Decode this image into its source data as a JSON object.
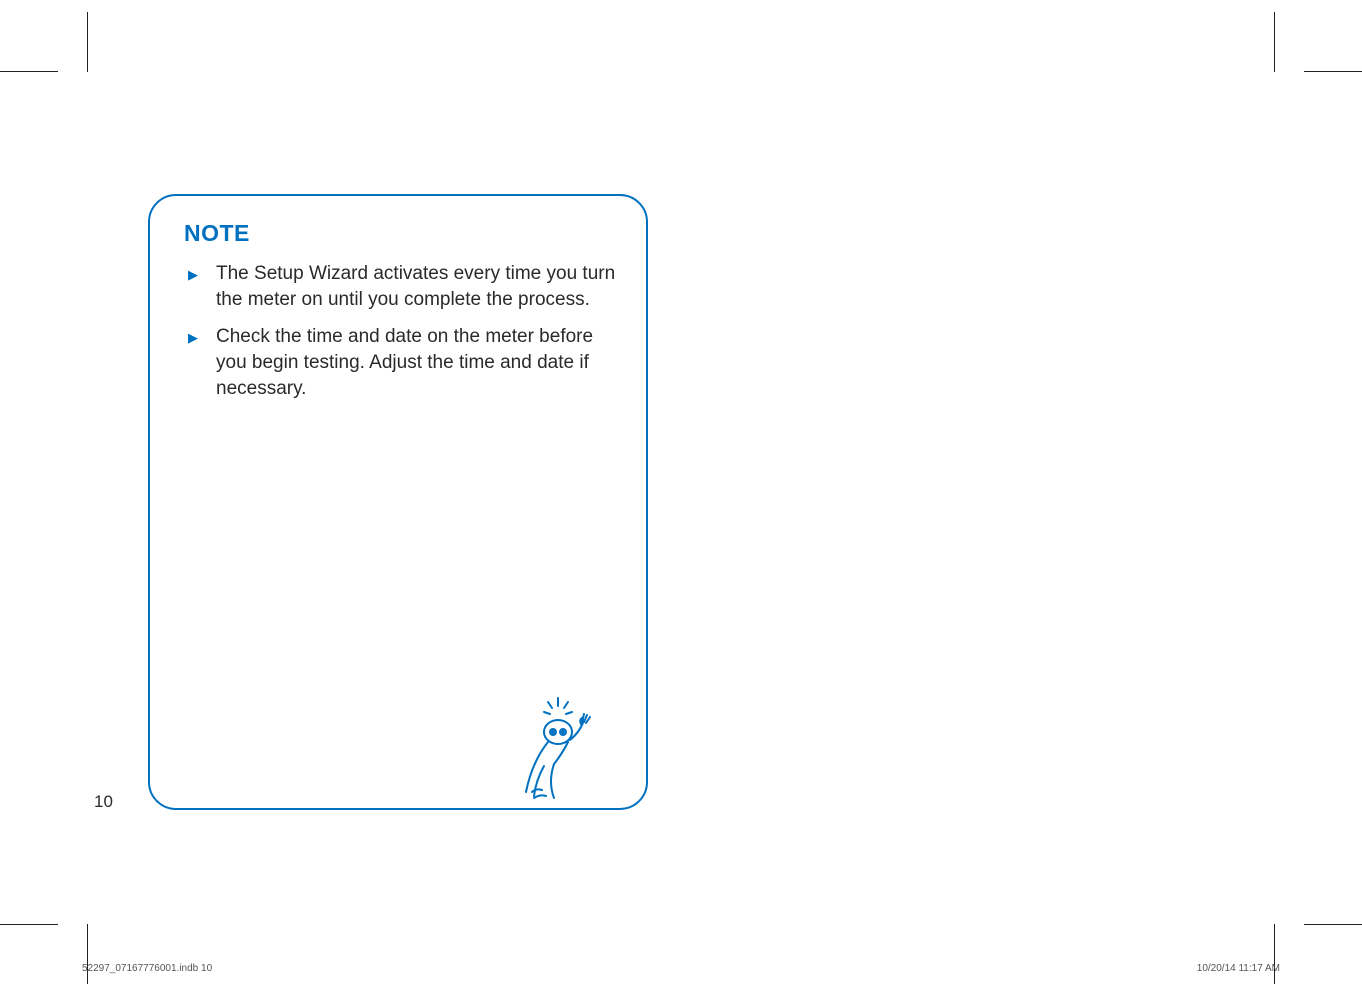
{
  "note": {
    "title": "NOTE",
    "items": [
      "The Setup Wizard activates every time you turn the meter on until you complete the process.",
      "Check the time and date on the meter before you begin testing. Adjust the time and date if necessary."
    ]
  },
  "page_number": "10",
  "footer": {
    "left": "52297_07167776001.indb   10",
    "right": "10/20/14   11:17 AM"
  }
}
